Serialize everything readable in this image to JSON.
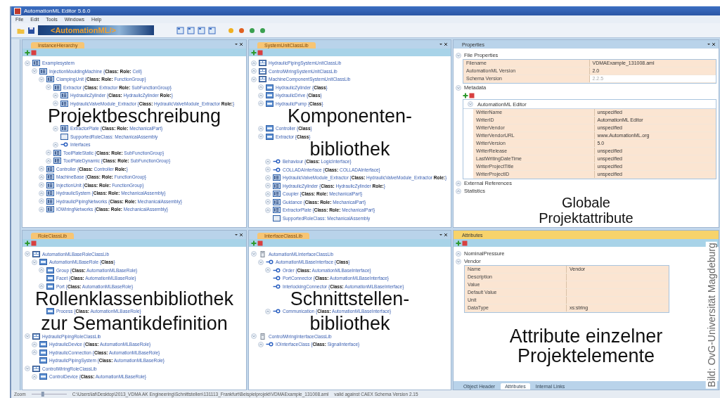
{
  "window": {
    "title": "AutomationML Editor 5.6.0"
  },
  "menu": [
    "File",
    "Edit",
    "Tools",
    "Windows",
    "Help"
  ],
  "toolbar": {
    "logo": "<AutomationML/>"
  },
  "instance_hierarchy": {
    "tab": "InstanceHierarchy",
    "caption": [
      "Projektbeschreibung"
    ],
    "items": [
      {
        "label": "Examplesystem",
        "kind": "ie",
        "expanded": true,
        "children": [
          {
            "label": "InjectionMouldingMachine {**Class:** **Role:** Cell}",
            "kind": "ie",
            "expanded": true,
            "children": [
              {
                "label": "ClampingUnit {**Class:** **Role:** FunctionGroup}",
                "kind": "ie",
                "expanded": true,
                "children": [
                  {
                    "label": "Extractor {**Class:** Extractor **Role:** SubFunctionGroup}",
                    "kind": "ie",
                    "expanded": true,
                    "children": [
                      {
                        "label": "HydraulicZylinder {**Class:** HydraulicZylinder **Role:**}",
                        "kind": "ie",
                        "expanded": false
                      },
                      {
                        "label": "HydraulicValveModule_Extractor {**Class:** HydraulicValveModule_Extractor **Role:**}",
                        "kind": "ie",
                        "expanded": false
                      },
                      {
                        "label": "ExtractorPlate {**Class:** **Role:** MechanicalPart}",
                        "kind": "ie",
                        "expanded": false
                      },
                      {
                        "label": "SupportedRoleClass: MechanicalAssembly",
                        "kind": "src"
                      },
                      {
                        "label": "Interfaces",
                        "kind": "interface",
                        "expanded": false
                      }
                    ]
                  },
                  {
                    "label": "ToolPlateStatic {**Class:** **Role:** SubFunctionGroup}",
                    "kind": "ie",
                    "expanded": false
                  },
                  {
                    "label": "ToolPlateDynamic {**Class:** **Role:** SubFunctionGroup}",
                    "kind": "ie",
                    "expanded": false
                  }
                ]
              },
              {
                "label": "Controller {**Class:** Controller **Role:**}",
                "kind": "ie",
                "expanded": false
              },
              {
                "label": "MachineBase {**Class:** **Role:** FunctionGroup}",
                "kind": "ie",
                "expanded": false
              },
              {
                "label": "InjectionUnit {**Class:** **Role:** FunctionGroup}",
                "kind": "ie",
                "expanded": false
              },
              {
                "label": "HydraulicSystem {**Class:** **Role:** MechanicalAssembly}",
                "kind": "ie",
                "expanded": false
              },
              {
                "label": "HydraulicPipingNetworks {**Class:** **Role:** MechanicalAssembly}",
                "kind": "ie",
                "expanded": false
              },
              {
                "label": "IOWiringNetworks {**Class:** **Role:** MechanicalAssembly}",
                "kind": "ie",
                "expanded": false
              }
            ]
          }
        ]
      }
    ]
  },
  "system_unit_class_lib": {
    "tab": "SystemUnitClassLib",
    "caption": [
      "Komponenten-",
      "bibliothek"
    ],
    "items": [
      {
        "label": "HydraulicPipingSystemUnitClassLib",
        "kind": "lib",
        "expanded": false
      },
      {
        "label": "ControlWiringSystemUnitClassLib",
        "kind": "lib",
        "expanded": false
      },
      {
        "label": "MachineComponentSystemUnitClassLib",
        "kind": "lib",
        "expanded": true,
        "children": [
          {
            "label": "HydraulicZylinder {**Class**}",
            "kind": "suc",
            "expanded": false
          },
          {
            "label": "HydraulicDrive {**Class**}",
            "kind": "suc",
            "expanded": false
          },
          {
            "label": "HydraulicPump {**Class**}",
            "kind": "suc",
            "expanded": false
          },
          {
            "label": "Controller {**Class**}",
            "kind": "suc",
            "expanded": false
          },
          {
            "label": "Extractor {**Class**}",
            "kind": "suc",
            "expanded": true,
            "children": [
              {
                "label": "Behaviour {**Class:** LogicInterface}",
                "kind": "interface",
                "expanded": false
              },
              {
                "label": "COLLADAInterface {**Class:** COLLADAInterface}",
                "kind": "interface",
                "expanded": false
              },
              {
                "label": "HydraulicValveModule_Extractor {**Class:** HydraulicValveModule_Extractor **Role:**}",
                "kind": "ie",
                "expanded": false
              },
              {
                "label": "HydraulicZylinder {**Class:** HydraulicZylinder **Role:**}",
                "kind": "ie",
                "expanded": false
              },
              {
                "label": "Coupler {**Class:** **Role:** MechanicalPart}",
                "kind": "ie",
                "expanded": false
              },
              {
                "label": "Guidance {**Class:** **Role:** MechanicalPart}",
                "kind": "ie",
                "expanded": false
              },
              {
                "label": "ExtractorPlate {**Class:** **Role:** MechanicalPart}",
                "kind": "ie",
                "expanded": false
              },
              {
                "label": "SupportedRoleClass: MechanicalAssembly",
                "kind": "src"
              }
            ]
          }
        ]
      }
    ]
  },
  "properties": {
    "title": "Properties",
    "caption": [
      "Globale",
      "Projektattribute"
    ],
    "sections": [
      {
        "label": "File Properties",
        "expanded": true,
        "rows": [
          {
            "name": "Filename",
            "value": "VDMAExample_131008.aml",
            "disabled": false
          },
          {
            "name": "AutomationML Version",
            "value": "2.0",
            "disabled": false
          },
          {
            "name": "Schema Version",
            "value": "2.2.5",
            "disabled": true
          }
        ]
      },
      {
        "label": "Metadata",
        "expanded": true,
        "group": {
          "label": "AutomationML Editor",
          "expanded": true,
          "rows": [
            {
              "name": "WriterName",
              "value": "unspecified",
              "disabled": false
            },
            {
              "name": "WriterID",
              "value": "AutomationML Editor",
              "disabled": false
            },
            {
              "name": "WriterVendor",
              "value": "unspecified",
              "disabled": false
            },
            {
              "name": "WriterVendorURL",
              "value": "www.AutomationML.org",
              "disabled": false
            },
            {
              "name": "WriterVersion",
              "value": "5.0",
              "disabled": false
            },
            {
              "name": "WriterRelease",
              "value": "unspecified",
              "disabled": false
            },
            {
              "name": "LastWritingDateTime",
              "value": "unspecified",
              "disabled": false
            },
            {
              "name": "WriterProjectTitle",
              "value": "unspecified",
              "disabled": false
            },
            {
              "name": "WriterProjectID",
              "value": "unspecified",
              "disabled": false
            }
          ]
        }
      },
      {
        "label": "External References",
        "expanded": false
      },
      {
        "label": "Statistics",
        "expanded": false
      }
    ]
  },
  "role_class_lib": {
    "tab": "RoleClassLib",
    "caption": [
      "Rollenklassenbibliothek",
      "zur Semantikdefinition"
    ],
    "items": [
      {
        "label": "AutomationMLBaseRoleClassLib",
        "kind": "lib",
        "expanded": true,
        "children": [
          {
            "label": "AutomationMLBaseRole {**Class**}",
            "kind": "rc",
            "expanded": true,
            "children": [
              {
                "label": "Group {**Class:** AutomationMLBaseRole}",
                "kind": "rc",
                "expanded": false
              },
              {
                "label": "Facet {**Class:** AutomationMLBaseRole}",
                "kind": "rc"
              },
              {
                "label": "Port {**Class:** AutomationMLBaseRole}",
                "kind": "rc",
                "expanded": false
              },
              {
                "label": "Process {**Class:** AutomationMLBaseRole}",
                "kind": "rc"
              }
            ]
          }
        ]
      },
      {
        "label": "HydraulicPipingRoleClassLib",
        "kind": "lib",
        "expanded": true,
        "children": [
          {
            "label": "HydraulicDevice {**Class:** AutomationMLBaseRole}",
            "kind": "rc",
            "expanded": false
          },
          {
            "label": "HydraulicConnection {**Class:** AutomationMLBaseRole}",
            "kind": "rc",
            "expanded": false
          },
          {
            "label": "HydraulicPipingSystem {**Class:** AutomationMLBaseRole}",
            "kind": "rc"
          }
        ]
      },
      {
        "label": "ControlWiringRoleClassLib",
        "kind": "lib",
        "expanded": true,
        "children": [
          {
            "label": "ControlDevice {**Class:** AutomationMLBaseRole}",
            "kind": "rc",
            "expanded": false
          }
        ]
      }
    ]
  },
  "interface_class_lib": {
    "tab": "InterfaceClassLib",
    "caption": [
      "Schnittstellen-",
      "bibliothek"
    ],
    "items": [
      {
        "label": "AutomationMLInterfaceClassLib",
        "kind": "ilib",
        "expanded": true,
        "children": [
          {
            "label": "AutomationMLBaseInterface {**Class**}",
            "kind": "interface",
            "expanded": true,
            "children": [
              {
                "label": "Order {**Class:** AutomationMLBaseInterface}",
                "kind": "interface",
                "expanded": false
              },
              {
                "label": "PortConnector {**Class:** AutomationMLBaseInterface}",
                "kind": "interface"
              },
              {
                "label": "InterlockingConnector {**Class:** AutomationMLBaseInterface}",
                "kind": "interface"
              },
              {
                "label": "Communication {**Class:** AutomationMLBaseInterface}",
                "kind": "interface",
                "expanded": false
              }
            ]
          }
        ]
      },
      {
        "label": "ControlWiringInterfaceClassLib",
        "kind": "ilib",
        "expanded": true,
        "children": [
          {
            "label": "IOInterfaceClass {**Class:** SignalInterface}",
            "kind": "interface",
            "expanded": false
          }
        ]
      }
    ]
  },
  "attributes": {
    "title": "Attributes",
    "caption": [
      "Attribute einzelner",
      "Projektelemente"
    ],
    "items": [
      {
        "label": "NominalPressure",
        "expanded": false
      },
      {
        "label": "Vendor",
        "expanded": true,
        "rows": [
          {
            "name": "Name",
            "value": "Vendor"
          },
          {
            "name": "Description"
          },
          {
            "name": "Value"
          },
          {
            "name": "Default Value"
          },
          {
            "name": "Unit"
          },
          {
            "name": "DataType",
            "value": "xs:string"
          }
        ]
      }
    ],
    "tabs": [
      {
        "label": "Object Header",
        "selected": false
      },
      {
        "label": "Attributes",
        "selected": true
      },
      {
        "label": "Internal Links",
        "selected": false
      }
    ]
  },
  "status_bar": {
    "zoom_label": "Zoom",
    "level": 0.3,
    "path": "C:\\Users\\laf\\Desktop\\2013_VDMA AK Engineering\\Schnittstellen\\131113_Frankfurt\\Beispielprojekt\\VDMAExample_131008.aml",
    "validation": "valid against CAEX Schema Version 2.15"
  },
  "credit": "Bild: OvG-Universität Magdeburg"
}
